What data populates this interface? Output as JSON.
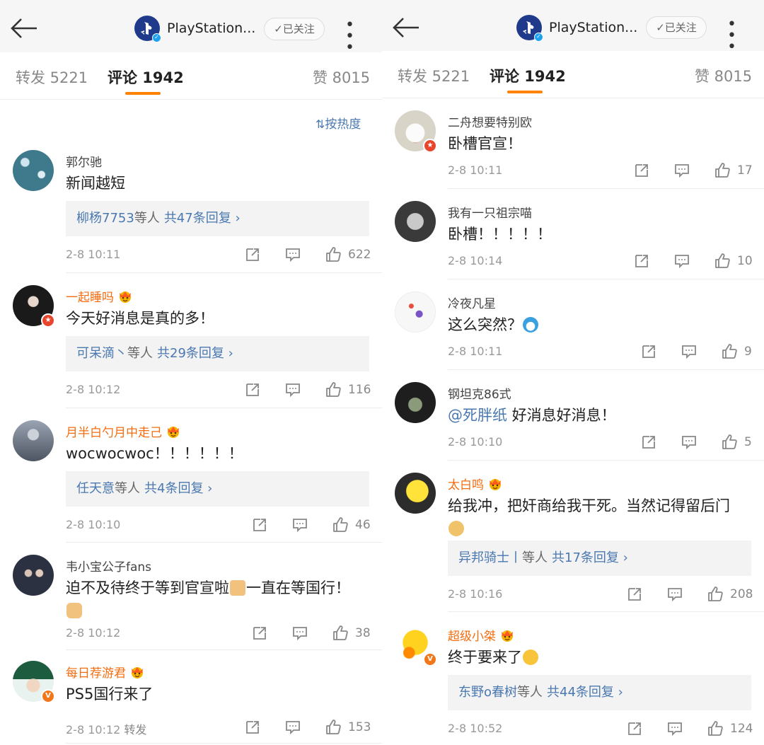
{
  "left": {
    "header": {
      "account_name": "PlayStation...",
      "follow_label": "✓已关注",
      "more_label": "• • •"
    },
    "tabs": [
      {
        "label": "转发 5221"
      },
      {
        "label": "评论 1942"
      },
      {
        "label": "赞 8015"
      }
    ],
    "sort_label": "按热度",
    "comments": [
      {
        "username": "郭尔驰",
        "content": "新闻越短",
        "reply_user": "柳杨7753",
        "reply_mid": "等人",
        "reply_count": "共47条回复 ›",
        "time": "2-8 10:11",
        "likes": "622"
      },
      {
        "username": "一起睡吗",
        "content": "今天好消息是真的多！",
        "reply_user": "可呆滴丶",
        "reply_mid": "等人",
        "reply_count": "共29条回复 ›",
        "time": "2-8 10:12",
        "likes": "116"
      },
      {
        "username": "月半白勺月中走己",
        "content": "wocwocwoc！！！！！！",
        "reply_user": "任天意",
        "reply_mid": "等人",
        "reply_count": "共4条回复 ›",
        "time": "2-8 10:10",
        "likes": "46"
      },
      {
        "username": "韦小宝公子fans",
        "content_a": "迫不及待终于等到官宣啦",
        "content_b": "一直在等国行！",
        "time": "2-8 10:12",
        "likes": "38"
      },
      {
        "username": "每日荐游君",
        "content": "PS5国行来了",
        "time": "2-8 10:12",
        "forward": "转发",
        "likes": "153"
      }
    ]
  },
  "right": {
    "header": {
      "account_name": "PlayStation...",
      "follow_label": "✓已关注",
      "more_label": "• • •"
    },
    "tabs": [
      {
        "label": "转发 5221"
      },
      {
        "label": "评论 1942"
      },
      {
        "label": "赞 8015"
      }
    ],
    "comments": [
      {
        "username": "二舟想要特别欧",
        "content": "卧槽官宣！",
        "time": "2-8 10:11",
        "likes": "17"
      },
      {
        "username": "我有一只祖宗喵",
        "content": "卧槽！！！！！",
        "time": "2-8 10:14",
        "likes": "10"
      },
      {
        "username": "冷夜凡星",
        "content": "这么突然？",
        "time": "2-8 10:11",
        "likes": "9"
      },
      {
        "username": "钢坦克86式",
        "mention": "@死胖纸",
        "content": " 好消息好消息！",
        "time": "2-8 10:10",
        "likes": "5"
      },
      {
        "username": "太白鸣",
        "content": "给我冲，把奸商给我干死。当然记得留后门",
        "reply_user": "异邦骑士丨",
        "reply_mid": "等人",
        "reply_count": "共17条回复 ›",
        "time": "2-8 10:16",
        "likes": "208"
      },
      {
        "username": "超级小桀",
        "content": "终于要来了",
        "reply_user": "东野o春树",
        "reply_mid": "等人",
        "reply_count": "共44条回复 ›",
        "time": "2-8 10:52",
        "likes": "124"
      }
    ]
  },
  "colors": {
    "accent": "#ff8200",
    "link": "#4a78b0",
    "vip_name": "#f36d10"
  }
}
